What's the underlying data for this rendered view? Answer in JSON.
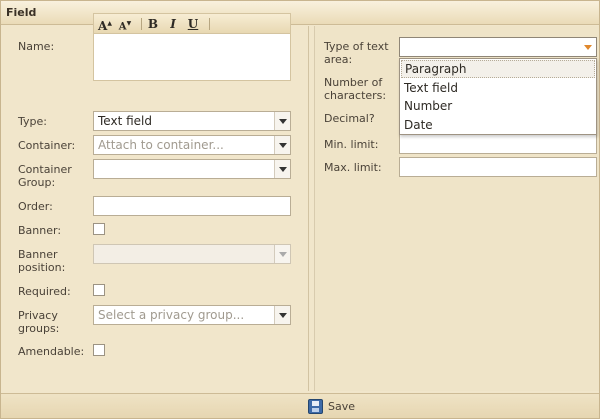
{
  "window": {
    "title": "Field"
  },
  "form_left": {
    "name_label": "Name:",
    "rte": {
      "increase_font": "A",
      "decrease_font": "A",
      "bold": "B",
      "italic": "I",
      "underline": "U"
    },
    "type_label": "Type:",
    "type_value": "Text field",
    "container_label": "Container:",
    "container_placeholder": "Attach to container...",
    "container_group_label": "Container\nGroup:",
    "order_label": "Order:",
    "banner_label": "Banner:",
    "banner_position_label": "Banner\nposition:",
    "required_label": "Required:",
    "privacy_groups_label": "Privacy\ngroups:",
    "privacy_groups_placeholder": "Select a privacy group...",
    "amendable_label": "Amendable:"
  },
  "form_right": {
    "type_of_text_area_label": "Type of text\narea:",
    "type_of_text_area_options": [
      "Paragraph",
      "Text field",
      "Number",
      "Date"
    ],
    "number_of_characters_label": "Number of\ncharacters:",
    "decimal_label": "Decimal?",
    "min_limit_label": "Min. limit:",
    "max_limit_label": "Max. limit:"
  },
  "footer": {
    "save_label": "Save"
  }
}
